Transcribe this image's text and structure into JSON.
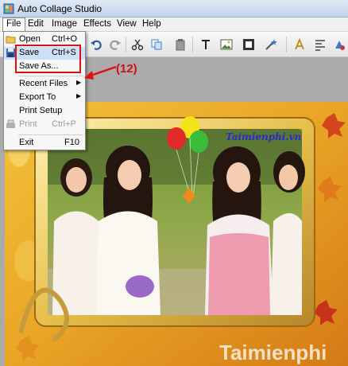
{
  "window": {
    "title": "Auto Collage Studio"
  },
  "menu": {
    "file": "File",
    "edit": "Edit",
    "image": "Image",
    "effects": "Effects",
    "view": "View",
    "help": "Help"
  },
  "file_menu": {
    "open": {
      "label": "Open",
      "shortcut": "Ctrl+O"
    },
    "save": {
      "label": "Save",
      "shortcut": "Ctrl+S"
    },
    "save_as": {
      "label": "Save As..."
    },
    "recent_files": {
      "label": "Recent Files"
    },
    "export_to": {
      "label": "Export To"
    },
    "print_setup": {
      "label": "Print Setup"
    },
    "print": {
      "label": "Print",
      "shortcut": "Ctrl+P"
    },
    "exit": {
      "label": "Exit",
      "shortcut": "F10"
    }
  },
  "annotation": {
    "step": "(12)"
  },
  "watermarks": {
    "top": "Taimienphi.vn",
    "bottom": "Taimienphi"
  },
  "colors": {
    "highlight_red": "#e01010",
    "menu_highlight": "#cde0f7"
  }
}
